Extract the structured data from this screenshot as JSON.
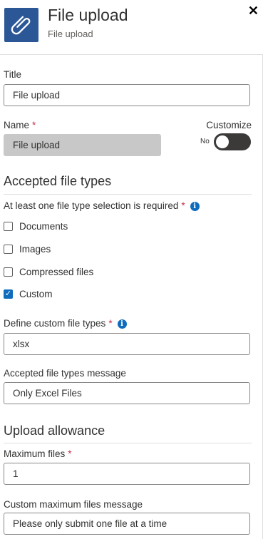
{
  "header": {
    "title": "File upload",
    "subtitle": "File upload",
    "icon": "paperclip-icon",
    "icon_bg": "#2b5797"
  },
  "close": {
    "glyph": "✕",
    "icon": "close-icon"
  },
  "fields": {
    "title": {
      "label": "Title",
      "value": "File upload"
    },
    "name": {
      "label": "Name",
      "required": "*",
      "value": "File upload"
    },
    "customize": {
      "label": "Customize",
      "toggle_text": "No",
      "on": false
    }
  },
  "accepted": {
    "heading": "Accepted file types",
    "hint": "At least one file type selection is required",
    "required": "*",
    "options": [
      {
        "label": "Documents",
        "checked": false
      },
      {
        "label": "Images",
        "checked": false
      },
      {
        "label": "Compressed files",
        "checked": false
      },
      {
        "label": "Custom",
        "checked": true
      }
    ],
    "custom_types": {
      "label": "Define custom file types",
      "required": "*",
      "value": "xlsx"
    },
    "message": {
      "label": "Accepted file types message",
      "value": "Only Excel Files"
    }
  },
  "allowance": {
    "heading": "Upload allowance",
    "max_files": {
      "label": "Maximum files",
      "required": "*",
      "value": "1"
    },
    "max_message": {
      "label": "Custom maximum files message",
      "value": "Please only submit one file at a time"
    }
  },
  "colors": {
    "accent": "#0f6cbd",
    "required": "#c4314b",
    "toggle_off": "#3b3a39"
  }
}
